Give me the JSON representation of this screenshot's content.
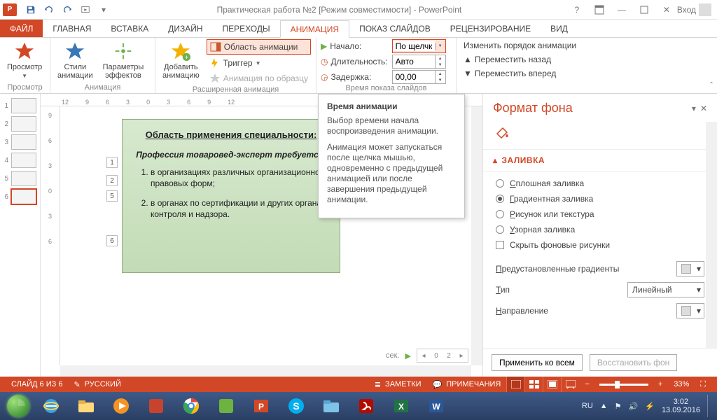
{
  "title": "Практическая работа №2 [Режим совместимости] - PowerPoint",
  "login": "Вход",
  "tabs": [
    "ФАЙЛ",
    "ГЛАВНАЯ",
    "ВСТАВКА",
    "ДИЗАЙН",
    "ПЕРЕХОДЫ",
    "АНИМАЦИЯ",
    "ПОКАЗ СЛАЙДОВ",
    "РЕЦЕНЗИРОВАНИЕ",
    "ВИД"
  ],
  "active_tab_index": 5,
  "ribbon": {
    "preview": {
      "btn": "Просмотр",
      "group": "Просмотр"
    },
    "anim": {
      "styles": "Стили\nанимации",
      "effects": "Параметры\nэффектов",
      "group": "Анимация"
    },
    "adv": {
      "add": "Добавить\nанимацию",
      "pane": "Область анимации",
      "trigger": "Триггер",
      "painter": "Анимация по образцу",
      "group": "Расширенная анимация"
    },
    "timing": {
      "start_lbl": "Начало:",
      "start_val": "По щелчку",
      "dur_lbl": "Длительность:",
      "dur_val": "Авто",
      "delay_lbl": "Задержка:",
      "delay_val": "00,00",
      "group": "Время показа слайдов"
    },
    "reorder": {
      "title": "Изменить порядок анимации",
      "back": "Переместить назад",
      "fwd": "Переместить вперед"
    }
  },
  "tooltip": {
    "title": "Время анимации",
    "p1": "Выбор времени начала воспроизведения анимации.",
    "p2": "Анимация может запускаться после щелчка мышью, одновременно с предыдущей анимацией или после завершения предыдущей анимации."
  },
  "ruler_h": [
    "12",
    "9",
    "6",
    "3",
    "0",
    "3",
    "6",
    "9",
    "12"
  ],
  "ruler_v": [
    "9",
    "6",
    "3",
    "0",
    "3",
    "6"
  ],
  "slide": {
    "heading": "Область применения специальности:",
    "sub": "Профессия товаровед-эксперт требуется:",
    "li1": "в организациях различных организационно-правовых форм;",
    "li2": "в органах по сертификации и других органах контроля и надзора.",
    "tags": [
      "1",
      "2",
      "5",
      "6"
    ]
  },
  "canvas_footer": {
    "sec": "сек.",
    "p0": "0",
    "p2": "2"
  },
  "format_pane": {
    "title": "Формат фона",
    "section": "ЗАЛИВКА",
    "r_solid": "Сплошная заливка",
    "r_grad": "Градиентная заливка",
    "r_pic": "Рисунок или текстура",
    "r_pat": "Узорная заливка",
    "chk_hide": "Скрыть фоновые рисунки",
    "preset": "Предустановленные градиенты",
    "type_lbl": "Тип",
    "type_val": "Линейный",
    "dir": "Направление",
    "apply": "Применить ко всем",
    "reset": "Восстановить фон"
  },
  "status": {
    "slide": "СЛАЙД 6 ИЗ 6",
    "lang": "РУССКИЙ",
    "notes": "ЗАМЕТКИ",
    "comments": "ПРИМЕЧАНИЯ",
    "zoom": "33%"
  },
  "tray": {
    "lang": "RU",
    "time": "3:02",
    "date": "13.09.2016"
  }
}
